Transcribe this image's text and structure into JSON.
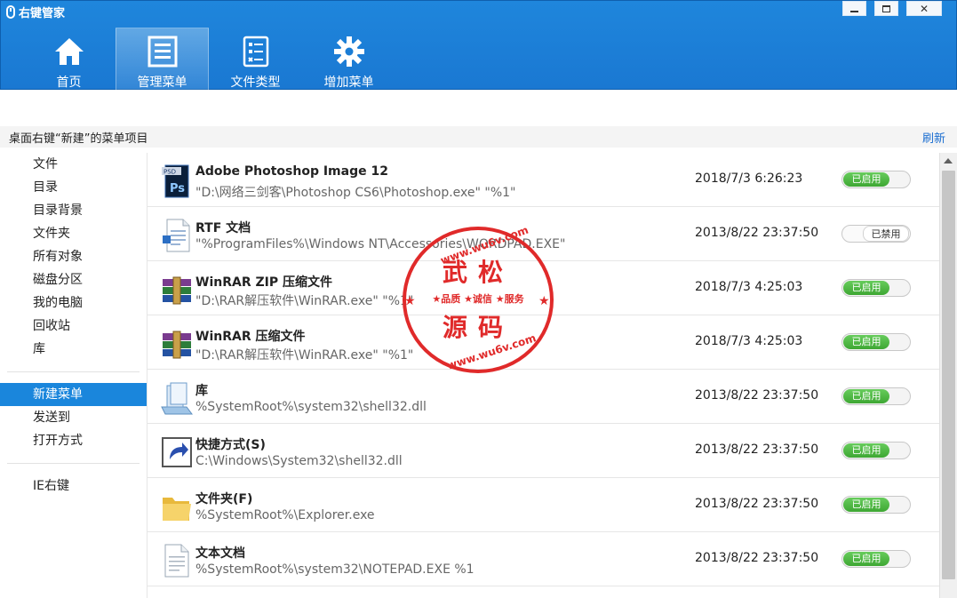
{
  "app": {
    "title": "右键管家"
  },
  "window_controls": {
    "minimize": "minimize",
    "maximize": "maximize",
    "close": "✕"
  },
  "nav": [
    {
      "label": "首页",
      "icon": "home-icon",
      "active": false
    },
    {
      "label": "管理菜单",
      "icon": "list-icon",
      "active": true
    },
    {
      "label": "文件类型",
      "icon": "file-type-icon",
      "active": false
    },
    {
      "label": "增加菜单",
      "icon": "gear-icon",
      "active": false
    }
  ],
  "section": {
    "title": "桌面右键“新建”的菜单项目",
    "refresh": "刷新"
  },
  "sidebar": {
    "group1": [
      "文件",
      "目录",
      "目录背景",
      "文件夹",
      "所有对象",
      "磁盘分区",
      "我的电脑",
      "回收站",
      "库"
    ],
    "group2": [
      "新建菜单",
      "发送到",
      "打开方式"
    ],
    "group3": [
      "IE右键"
    ],
    "active": "新建菜单"
  },
  "items": [
    {
      "name": "Adobe Photoshop Image 12",
      "path": "\"D:\\网络三剑客\\Photoshop CS6\\Photoshop.exe\" \"%1\"",
      "date": "2018/7/3 6:26:23",
      "status": "已启用",
      "enabled": true,
      "icon": "photoshop-file-icon"
    },
    {
      "name": "RTF 文档",
      "path": "\"%ProgramFiles%\\Windows NT\\Accessories\\WORDPAD.EXE\"",
      "date": "2013/8/22 23:37:50",
      "status": "已禁用",
      "enabled": false,
      "icon": "rtf-document-icon"
    },
    {
      "name": "WinRAR ZIP 压缩文件",
      "path": "\"D:\\RAR解压软件\\WinRAR.exe\" \"%1\"",
      "date": "2018/7/3 4:25:03",
      "status": "已启用",
      "enabled": true,
      "icon": "winrar-icon"
    },
    {
      "name": "WinRAR 压缩文件",
      "path": "\"D:\\RAR解压软件\\WinRAR.exe\" \"%1\"",
      "date": "2018/7/3 4:25:03",
      "status": "已启用",
      "enabled": true,
      "icon": "winrar-icon"
    },
    {
      "name": "库",
      "path": "%SystemRoot%\\system32\\shell32.dll",
      "date": "2013/8/22 23:37:50",
      "status": "已启用",
      "enabled": true,
      "icon": "library-icon"
    },
    {
      "name": "快捷方式(S)",
      "path": "C:\\Windows\\System32\\shell32.dll",
      "date": "2013/8/22 23:37:50",
      "status": "已启用",
      "enabled": true,
      "icon": "shortcut-icon"
    },
    {
      "name": "文件夹(F)",
      "path": "%SystemRoot%\\Explorer.exe",
      "date": "2013/8/22 23:37:50",
      "status": "已启用",
      "enabled": true,
      "icon": "folder-icon"
    },
    {
      "name": "文本文档",
      "path": "%SystemRoot%\\system32\\NOTEPAD.EXE %1",
      "date": "2013/8/22 23:37:50",
      "status": "已启用",
      "enabled": true,
      "icon": "text-document-icon"
    }
  ],
  "watermark": {
    "url": "www.wu6v.com",
    "line1": "武松",
    "line2": "源码",
    "slogan": "★品质 ★诚信 ★服务"
  },
  "colors": {
    "header": "#1a78d2",
    "accent": "#1a86dc",
    "enabled": "#4cb842",
    "stamp": "#e02a2a"
  }
}
